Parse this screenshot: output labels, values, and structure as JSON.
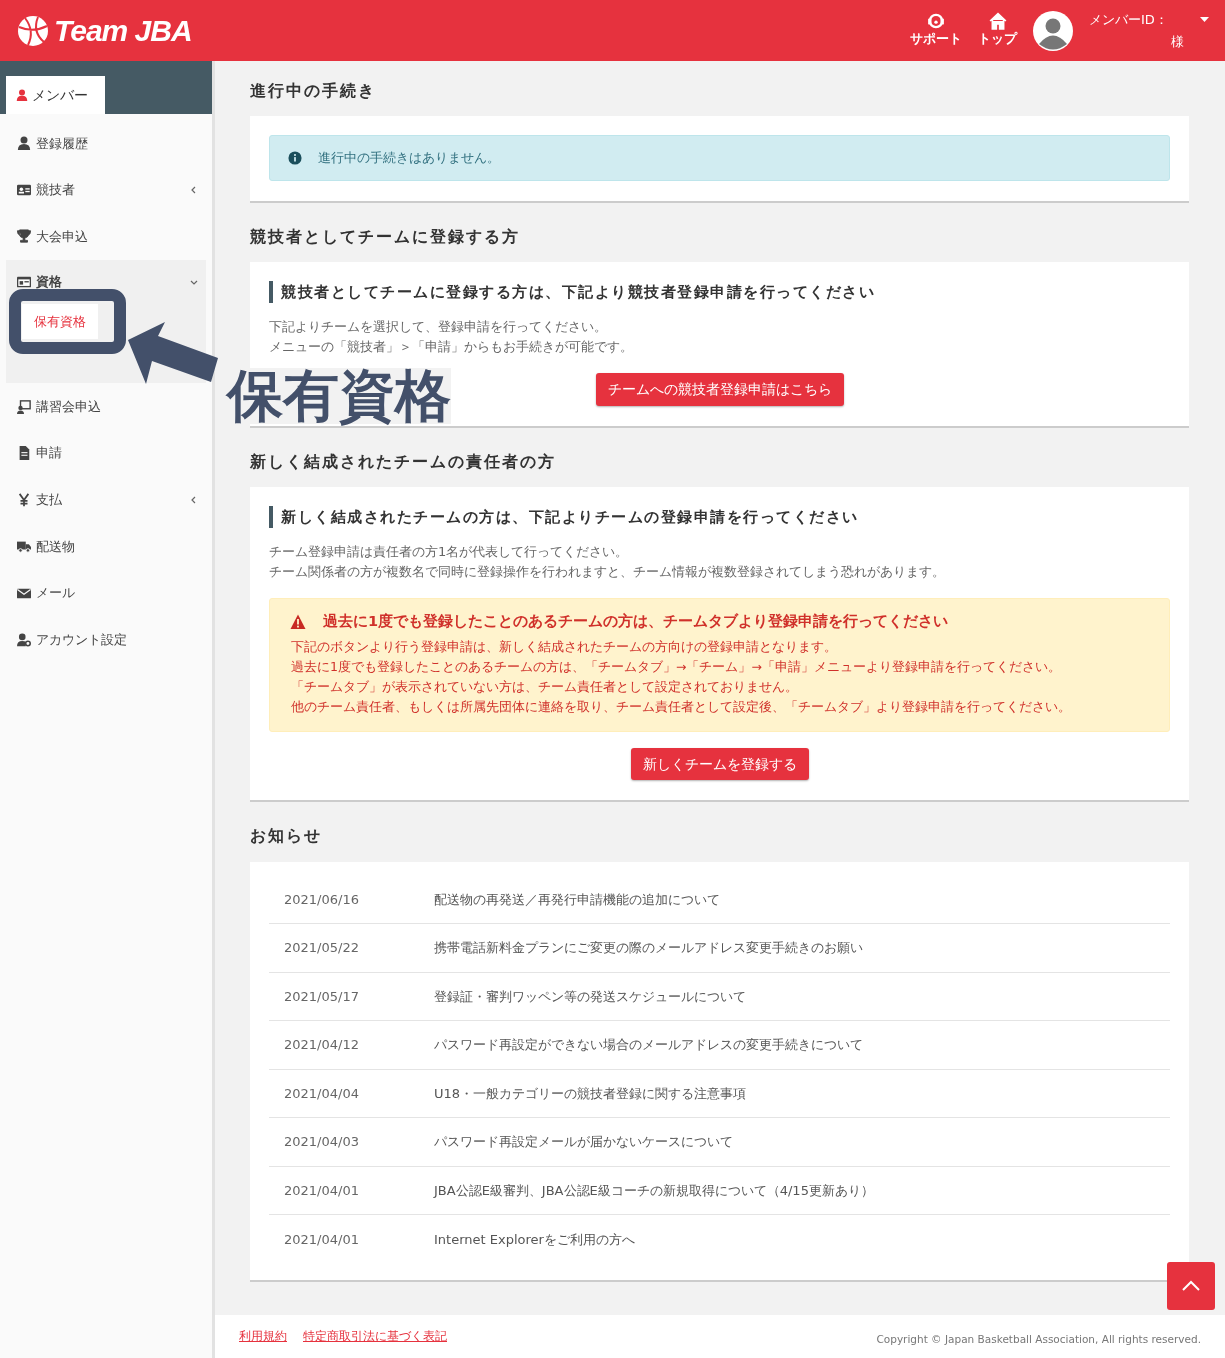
{
  "header": {
    "logo": "Team JBA",
    "nav": [
      {
        "label": "サポート"
      },
      {
        "label": "トップ"
      }
    ],
    "member_label": "メンバーID：",
    "honorific": "様"
  },
  "sidebar": {
    "tab": "メンバー",
    "items": [
      {
        "label": "登録履歴",
        "kind": "link"
      },
      {
        "label": "競技者",
        "kind": "group",
        "expanded": false
      },
      {
        "label": "大会申込",
        "kind": "link"
      },
      {
        "label": "資格",
        "kind": "group",
        "expanded": true,
        "children": [
          {
            "label": "保有資格",
            "selected": true
          }
        ]
      },
      {
        "label": "講習会申込",
        "kind": "link"
      },
      {
        "label": "申請",
        "kind": "link"
      },
      {
        "label": "支払",
        "kind": "group",
        "expanded": false
      },
      {
        "label": "配送物",
        "kind": "link"
      },
      {
        "label": "メール",
        "kind": "link"
      },
      {
        "label": "アカウント設定",
        "kind": "link"
      }
    ]
  },
  "annotation": {
    "label": "保有資格"
  },
  "in_progress": {
    "title": "進行中の手続き",
    "alert": "進行中の手続きはありません。"
  },
  "player_section": {
    "title": "競技者としてチームに登録する方",
    "heading": "競技者としてチームに登録する方は、下記より競技者登録申請を行ってください",
    "lines": [
      "下記よりチームを選択して、登録申請を行ってください。",
      "メニューの「競技者」＞「申請」からもお手続きが可能です。"
    ],
    "button": "チームへの競技者登録申請はこちら"
  },
  "team_section": {
    "title": "新しく結成されたチームの責任者の方",
    "heading": "新しく結成されたチームの方は、下記よりチームの登録申請を行ってください",
    "lines": [
      "チーム登録申請は責任者の方1名が代表して行ってください。",
      "チーム関係者の方が複数名で同時に登録操作を行われますと、チーム情報が複数登録されてしまう恐れがあります。"
    ],
    "warning": {
      "title": "過去に1度でも登録したことのあるチームの方は、チームタブより登録申請を行ってください",
      "lines": [
        "下記のボタンより行う登録申請は、新しく結成されたチームの方向けの登録申請となります。",
        "過去に1度でも登録したことのあるチームの方は、「チームタブ」→「チーム」→「申請」メニューより登録申請を行ってください。",
        "「チームタブ」が表示されていない方は、チーム責任者として設定されておりません。",
        "他のチーム責任者、もしくは所属先団体に連絡を取り、チーム責任者として設定後、「チームタブ」より登録申請を行ってください。"
      ]
    },
    "button": "新しくチームを登録する"
  },
  "news": {
    "title": "お知らせ",
    "items": [
      {
        "date": "2021/06/16",
        "text": "配送物の再発送／再発行申請機能の追加について"
      },
      {
        "date": "2021/05/22",
        "text": "携帯電話新料金プランにご変更の際のメールアドレス変更手続きのお願い"
      },
      {
        "date": "2021/05/17",
        "text": "登録証・審判ワッペン等の発送スケジュールについて"
      },
      {
        "date": "2021/04/12",
        "text": "パスワード再設定ができない場合のメールアドレスの変更手続きについて"
      },
      {
        "date": "2021/04/04",
        "text": "U18・一般カテゴリーの競技者登録に関する注意事項"
      },
      {
        "date": "2021/04/03",
        "text": "パスワード再設定メールが届かないケースについて"
      },
      {
        "date": "2021/04/01",
        "text": "JBA公認E級審判、JBA公認E級コーチの新規取得について（4/15更新あり）"
      },
      {
        "date": "2021/04/01",
        "text": "Internet Explorerをご利用の方へ"
      }
    ]
  },
  "footer": {
    "links": [
      "利用規約",
      "特定商取引法に基づく表記"
    ],
    "copyright": "Copyright © Japan Basketball Association, All rights reserved."
  }
}
